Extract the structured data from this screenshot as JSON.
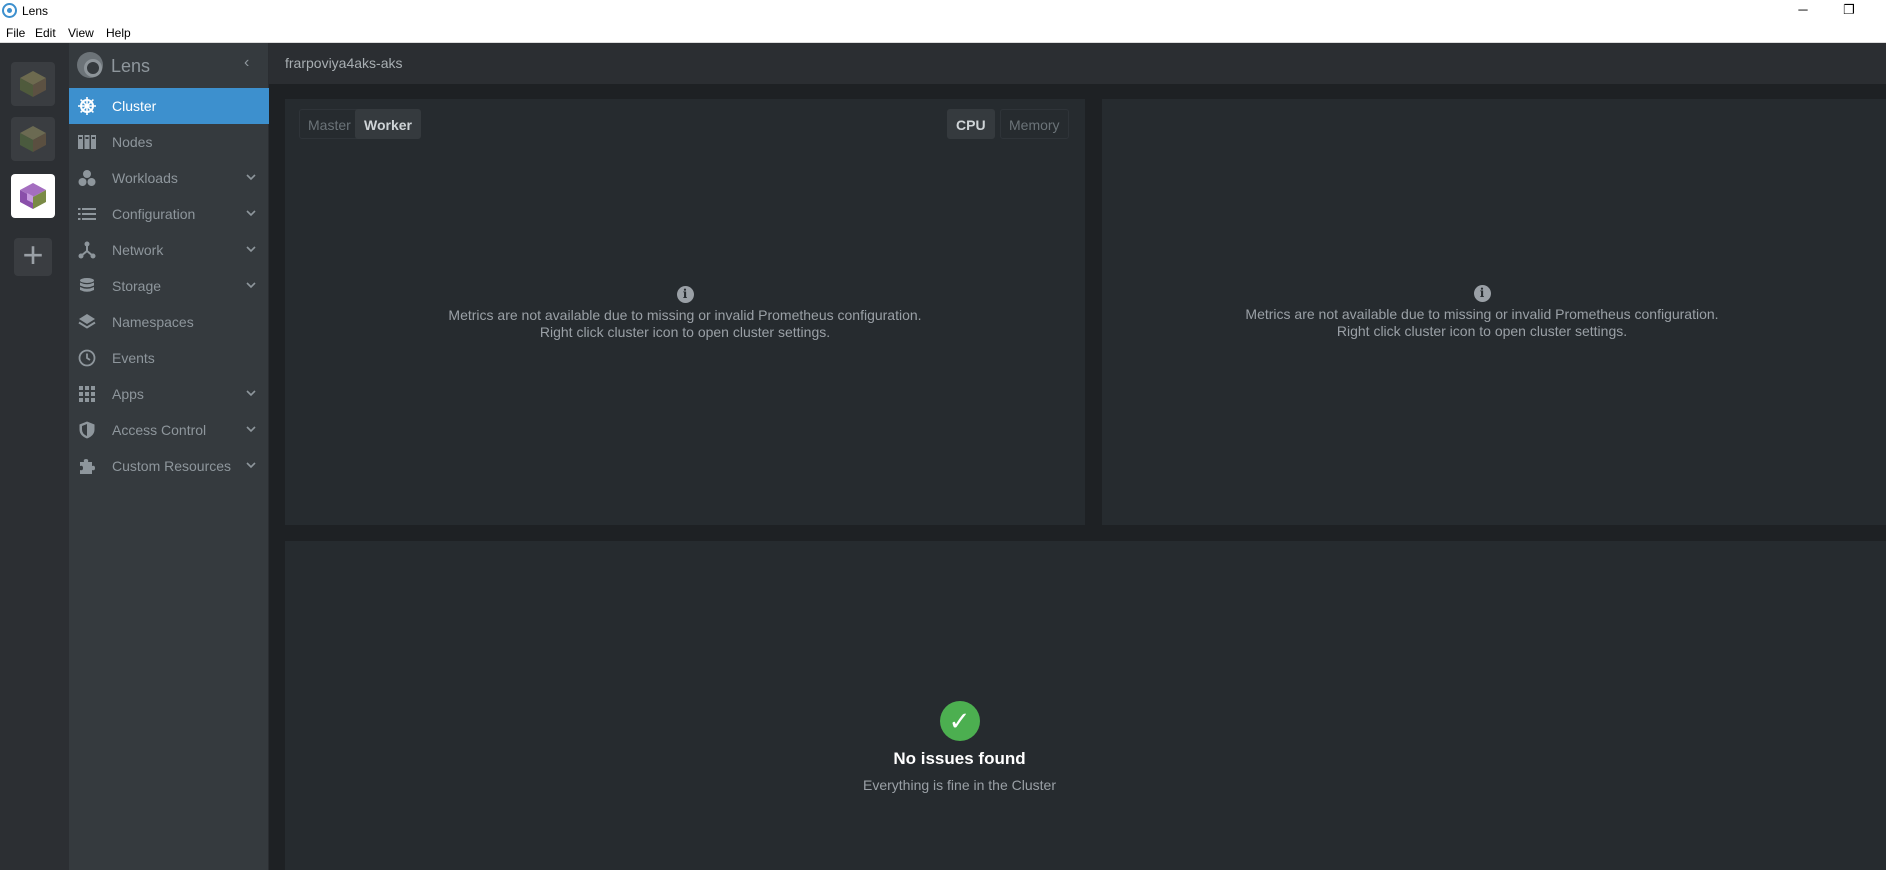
{
  "window": {
    "title": "Lens",
    "minimize_glyph": "─",
    "restore_glyph": "❐"
  },
  "menu": [
    "File",
    "Edit",
    "View",
    "Help"
  ],
  "rail": {
    "add_label": "+"
  },
  "sidebar": {
    "title": "Lens",
    "collapse_glyph": "‹",
    "items": [
      {
        "label": "Cluster",
        "icon": "helm-wheel-icon",
        "expandable": false
      },
      {
        "label": "Nodes",
        "icon": "nodes-icon",
        "expandable": false
      },
      {
        "label": "Workloads",
        "icon": "workloads-icon",
        "expandable": true
      },
      {
        "label": "Configuration",
        "icon": "list-icon",
        "expandable": true
      },
      {
        "label": "Network",
        "icon": "network-icon",
        "expandable": true
      },
      {
        "label": "Storage",
        "icon": "database-icon",
        "expandable": true
      },
      {
        "label": "Namespaces",
        "icon": "layers-icon",
        "expandable": false
      },
      {
        "label": "Events",
        "icon": "clock-icon",
        "expandable": false
      },
      {
        "label": "Apps",
        "icon": "grid-icon",
        "expandable": true
      },
      {
        "label": "Access Control",
        "icon": "shield-icon",
        "expandable": true
      },
      {
        "label": "Custom Resources",
        "icon": "puzzle-icon",
        "expandable": true
      }
    ]
  },
  "main": {
    "cluster_name": "frarpoviya4aks-aks",
    "node_tabs": {
      "master": "Master",
      "worker": "Worker",
      "selected": "Worker"
    },
    "metric_tabs": {
      "cpu": "CPU",
      "memory": "Memory",
      "selected": "CPU"
    },
    "metrics_notice_line1": "Metrics are not available due to missing or invalid Prometheus configuration.",
    "metrics_notice_line2": "Right click cluster icon to open cluster settings.",
    "info_glyph": "i",
    "issues": {
      "glyph": "✓",
      "title": "No issues found",
      "subtitle": "Everything is fine in the Cluster"
    }
  },
  "colors": {
    "accent": "#3d90ce",
    "success": "#4caf50"
  }
}
